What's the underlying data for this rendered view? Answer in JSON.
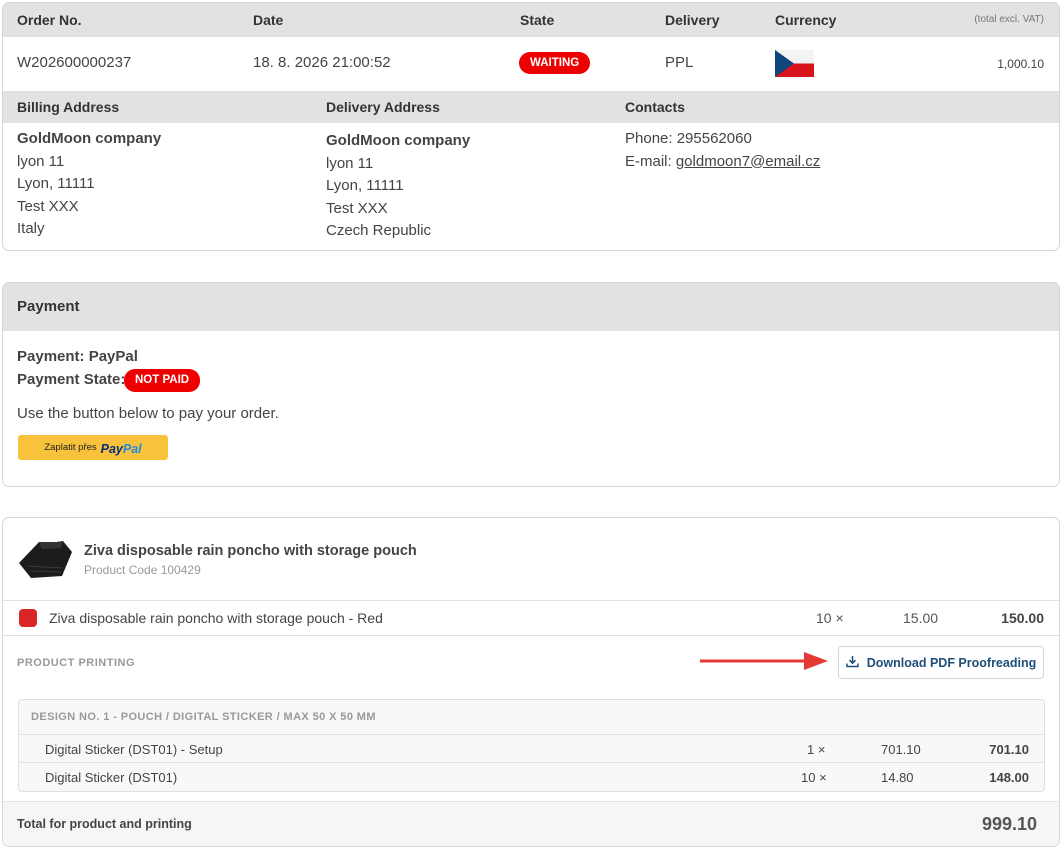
{
  "order": {
    "headers": {
      "order_no": "Order No.",
      "date": "Date",
      "state": "State",
      "delivery": "Delivery",
      "currency": "Currency",
      "total_note": "(total excl. VAT)"
    },
    "row": {
      "order_no": "W202600000237",
      "date": "18. 8. 2026 21:00:52",
      "state": "WAITING",
      "delivery": "PPL",
      "currency_flag": "czech-flag-icon",
      "total": "1,000.10"
    }
  },
  "addresses": {
    "headers": {
      "billing": "Billing Address",
      "delivery": "Delivery Address",
      "contacts": "Contacts"
    },
    "billing": [
      "GoldMoon company",
      "lyon 11",
      "Lyon, 11111",
      "Test XXX",
      "Italy"
    ],
    "delivery": [
      "GoldMoon company",
      "lyon 11",
      "Lyon, 11111",
      "Test XXX",
      "Czech Republic"
    ],
    "contacts": {
      "phone_label": "Phone:",
      "phone": "295562060",
      "email_label": "E-mail:",
      "email": "goldmoon7@email.cz"
    }
  },
  "payment": {
    "title": "Payment",
    "method_label": "Payment: PayPal",
    "state_label": "Payment State:",
    "state_badge": "NOT PAID",
    "instruction": "Use the button below to pay your order.",
    "button_small": "Zaplatit přes",
    "button_brand_1": "Pay",
    "button_brand_2": "Pal"
  },
  "product": {
    "name": "Ziva disposable rain poncho with storage pouch",
    "code": "Product Code 100429",
    "variant": {
      "name": "Ziva disposable rain poncho with storage pouch - Red",
      "qty": "10 ×",
      "unit_price": "15.00",
      "total": "150.00",
      "color": "#d92525"
    },
    "printing_label": "PRODUCT PRINTING",
    "download_button": "Download PDF Proofreading",
    "design": {
      "title": "DESIGN NO. 1 - POUCH / DIGITAL STICKER / MAX 50 X 50 MM",
      "rows": [
        {
          "name": "Digital Sticker (DST01) - Setup",
          "qty": "1 ×",
          "unit_price": "701.10",
          "total": "701.10"
        },
        {
          "name": "Digital Sticker (DST01)",
          "qty": "10 ×",
          "unit_price": "14.80",
          "total": "148.00"
        }
      ]
    },
    "total_label": "Total for product and printing",
    "total_value": "999.10"
  },
  "colors": {
    "badge_red": "#ee0000",
    "header_gray": "#e2e2e2",
    "paypal_yellow": "#f9c23c",
    "arrow_red": "#e53935"
  }
}
